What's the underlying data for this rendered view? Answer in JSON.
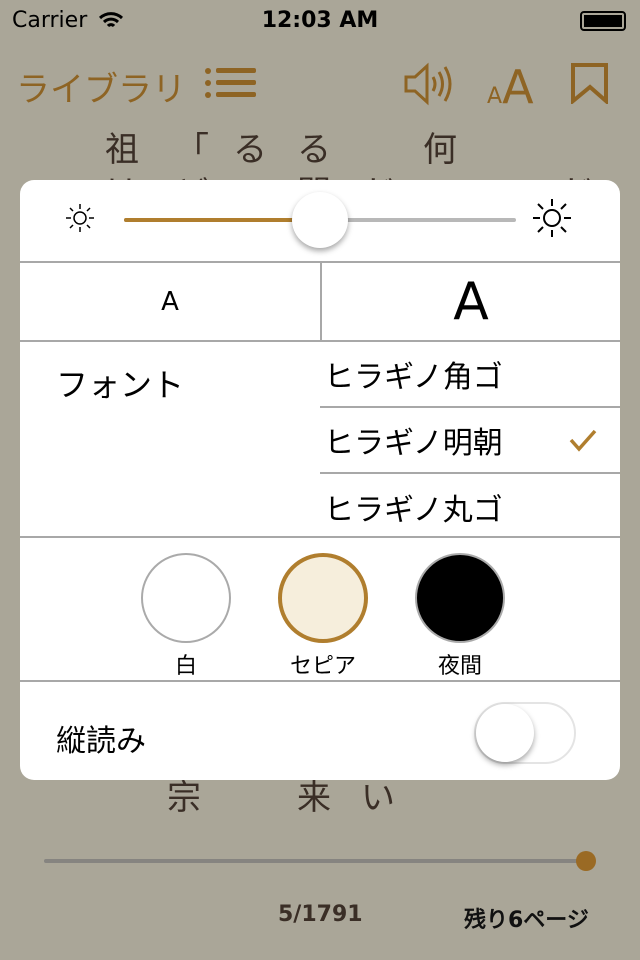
{
  "status": {
    "carrier": "Carrier",
    "time": "12:03 AM"
  },
  "nav": {
    "library": "ライブラリ",
    "icons": [
      "list-icon",
      "speaker-icon",
      "font-size-icon",
      "bookmark-icon"
    ],
    "font_small": "A",
    "font_large": "A"
  },
  "page_text": {
    "columns": [
      [
        "祖",
        "は"
      ],
      [
        "「",
        "ど"
      ],
      [
        "る",
        "の"
      ],
      [
        "る",
        "間"
      ],
      [
        "だ"
      ],
      [
        "何",
        "の"
      ],
      [
        "」"
      ],
      [
        "だ"
      ]
    ],
    "bottom": [
      "宗",
      "来",
      "い"
    ]
  },
  "popup": {
    "brightness": 0.5,
    "font_size": {
      "small": "A",
      "large": "A"
    },
    "font_label": "フォント",
    "fonts": [
      {
        "label": "ヒラギノ角ゴ",
        "selected": false
      },
      {
        "label": "ヒラギノ明朝",
        "selected": true
      },
      {
        "label": "ヒラギノ丸ゴ",
        "selected": false
      }
    ],
    "themes": [
      {
        "label": "白",
        "color": "#ffffff",
        "selected": false
      },
      {
        "label": "セピア",
        "color": "#f6eedc",
        "selected": true
      },
      {
        "label": "夜間",
        "color": "#000000",
        "selected": false
      }
    ],
    "vertical_label": "縦読み",
    "vertical_on": false
  },
  "footer": {
    "progress": 0.997,
    "page": "5/1791",
    "remaining": "残り6ページ"
  },
  "colors": {
    "accent": "#b07e2e",
    "background": "#aaa698"
  }
}
